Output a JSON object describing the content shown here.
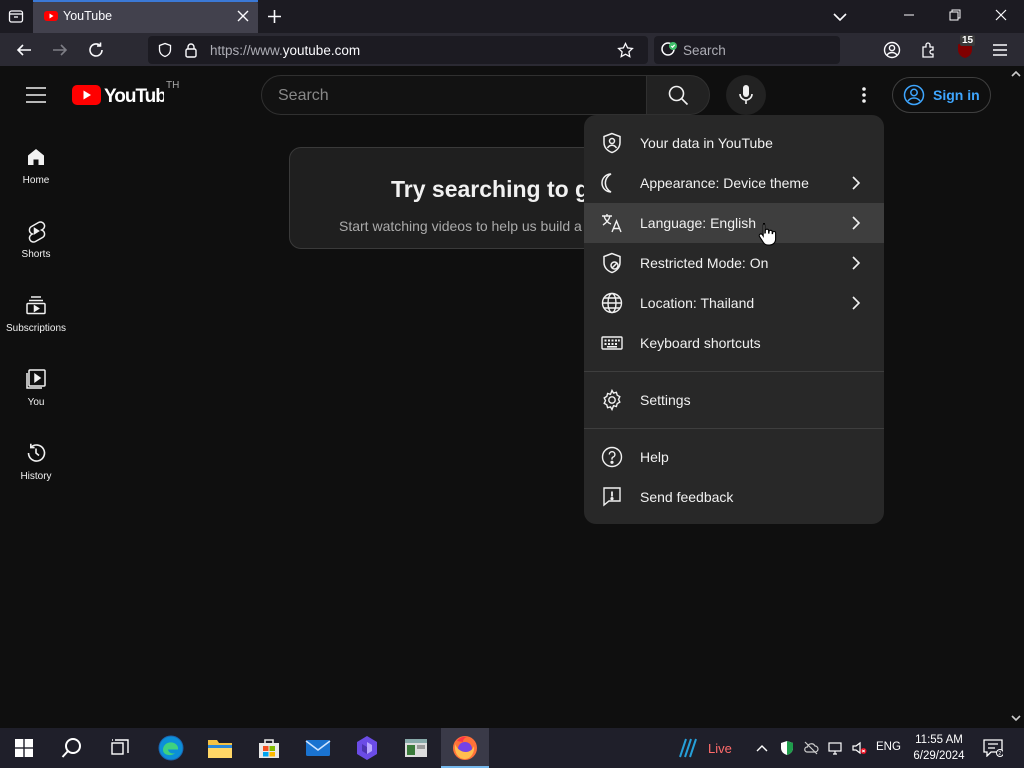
{
  "browser": {
    "tab_title": "YouTube",
    "url_host": "https://www.",
    "url_domain": "youtube.com",
    "search_placeholder": "Search",
    "extension_badge": "15"
  },
  "youtube": {
    "country_code": "TH",
    "search_placeholder": "Search",
    "signin_label": "Sign in",
    "rail": [
      {
        "label": "Home"
      },
      {
        "label": "Shorts"
      },
      {
        "label": "Subscriptions"
      },
      {
        "label": "You"
      },
      {
        "label": "History"
      }
    ],
    "empty_state": {
      "title": "Try searching to get started",
      "subtitle": "Start watching videos to help us build a feed of videos you'll love."
    }
  },
  "menu": {
    "items": [
      {
        "label": "Your data in YouTube",
        "icon": "shield-person-icon",
        "chevron": false
      },
      {
        "label": "Appearance: Device theme",
        "icon": "moon-icon",
        "chevron": true
      },
      {
        "label": "Language: English",
        "icon": "translate-icon",
        "chevron": true,
        "hover": true
      },
      {
        "label": "Restricted Mode: On",
        "icon": "restricted-shield-icon",
        "chevron": true
      },
      {
        "label": "Location: Thailand",
        "icon": "globe-icon",
        "chevron": true
      },
      {
        "label": "Keyboard shortcuts",
        "icon": "keyboard-icon",
        "chevron": false
      },
      {
        "label": "Settings",
        "icon": "gear-icon",
        "chevron": false
      },
      {
        "label": "Help",
        "icon": "help-icon",
        "chevron": false
      },
      {
        "label": "Send feedback",
        "icon": "feedback-icon",
        "chevron": false
      }
    ]
  },
  "taskbar": {
    "live_label": "Live",
    "language": "ENG",
    "time": "11:55 AM",
    "date": "6/29/2024"
  },
  "colors": {
    "accent_link": "#3ea6ff",
    "youtube_red": "#ff0000",
    "menu_bg": "#282828",
    "page_bg": "#0f0f0f"
  }
}
